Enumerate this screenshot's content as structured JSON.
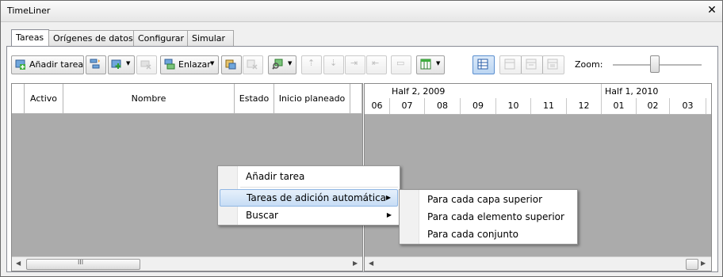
{
  "window": {
    "title": "TimeLiner",
    "close_glyph": "✕"
  },
  "tabs": [
    {
      "label": "Tareas"
    },
    {
      "label": "Orígenes de datos"
    },
    {
      "label": "Configurar"
    },
    {
      "label": "Simular"
    }
  ],
  "toolbar": {
    "add_task_label": "Añadir tarea",
    "link_label": "Enlazar",
    "zoom_label": "Zoom:"
  },
  "grid": {
    "columns": [
      "Activo",
      "Nombre",
      "Estado",
      "Inicio planeado"
    ]
  },
  "gantt": {
    "halves": [
      "Half 2, 2009",
      "Half 1, 2010"
    ],
    "months": [
      "06",
      "07",
      "08",
      "09",
      "10",
      "11",
      "12",
      "01",
      "02",
      "03"
    ]
  },
  "scroll": {
    "thumb_grip": "III"
  },
  "context_menu": {
    "items": [
      "Añadir tarea",
      "Tareas de adición automática",
      "Buscar"
    ],
    "submenu_arrow": "▶"
  },
  "submenu": {
    "items": [
      "Para cada capa superior",
      "Para cada elemento superior",
      "Para cada conjunto"
    ]
  },
  "colors": {
    "grid_background": "#ababab",
    "highlight": "#c7ddf5"
  }
}
